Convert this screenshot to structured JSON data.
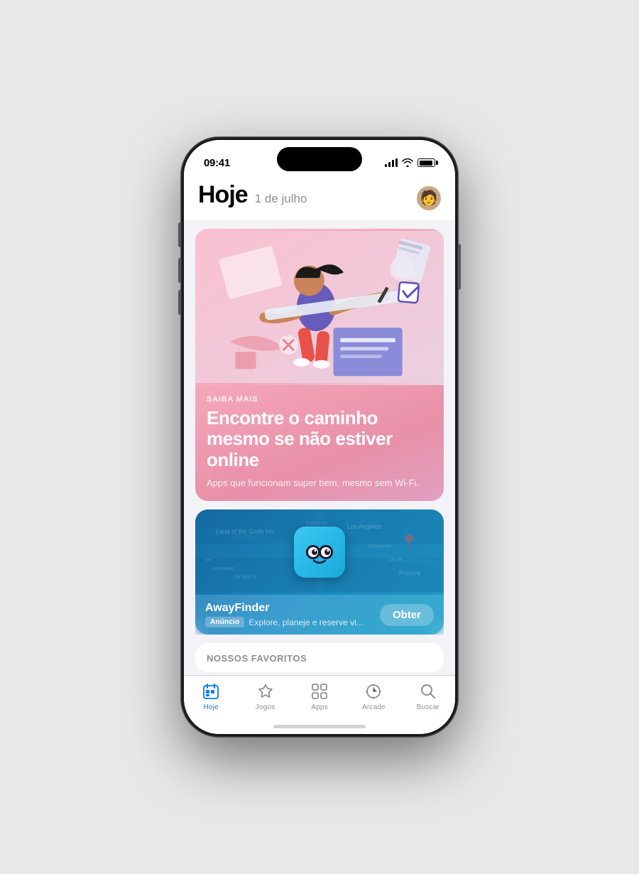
{
  "status": {
    "time": "09:41"
  },
  "header": {
    "title": "Hoje",
    "date": "1 de julho"
  },
  "featured": {
    "label": "SAIBA MAIS",
    "headline": "Encontre o caminho mesmo se não estiver online",
    "subtitle": "Apps que funcionam super bem, mesmo sem Wi-Fi."
  },
  "ad": {
    "app_name": "AwayFinder",
    "badge": "Anúncio",
    "description": "Explore, planeje e reserve vi...",
    "get_button": "Obter"
  },
  "section": {
    "title": "NOSSOS FAVORITOS"
  },
  "tabs": [
    {
      "id": "hoje",
      "label": "Hoje",
      "active": true
    },
    {
      "id": "jogos",
      "label": "Jogos",
      "active": false
    },
    {
      "id": "apps",
      "label": "Apps",
      "active": false
    },
    {
      "id": "arcade",
      "label": "Arcade",
      "active": false
    },
    {
      "id": "buscar",
      "label": "Buscar",
      "active": false
    }
  ]
}
